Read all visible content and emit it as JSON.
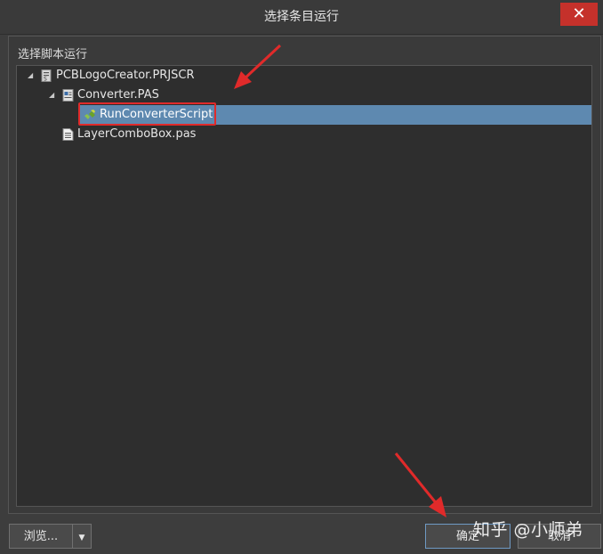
{
  "window": {
    "title": "选择条目运行",
    "close_label": "✕"
  },
  "panel": {
    "label": "选择脚本运行"
  },
  "tree": {
    "project": "PCBLogoCreator.PRJSCR",
    "file1": "Converter.PAS",
    "script": "RunConverterScript",
    "file2": "LayerComboBox.pas"
  },
  "buttons": {
    "browse": "浏览...",
    "ok": "确定",
    "cancel": "取消"
  },
  "watermark": "知乎 @小师弟",
  "colors": {
    "selection": "#5e89b0",
    "accent_red": "#e02a2a",
    "close": "#c5312b"
  }
}
